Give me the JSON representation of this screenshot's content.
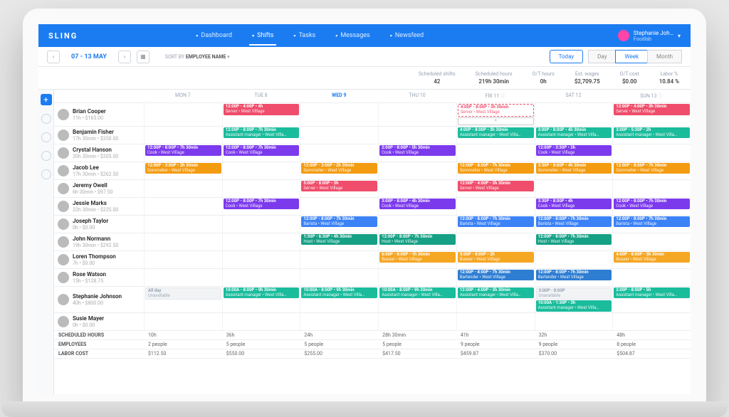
{
  "brand": "SLING",
  "nav": [
    {
      "icon": "dash",
      "label": "Dashboard",
      "active": false
    },
    {
      "icon": "grid",
      "label": "Shifts",
      "active": true
    },
    {
      "icon": "check",
      "label": "Tasks",
      "active": false
    },
    {
      "icon": "msg",
      "label": "Messages",
      "active": false
    },
    {
      "icon": "news",
      "label": "Newsfeed",
      "active": false
    }
  ],
  "user": {
    "name": "Stephanie Joh…",
    "org": "Foodlab"
  },
  "date_range": "07 - 13 MAY",
  "sort_label": "SORT BY",
  "sort_value": "EMPLOYEE NAME",
  "view": {
    "today": "Today",
    "day": "Day",
    "week": "Week",
    "month": "Month"
  },
  "stats": [
    {
      "label": "Scheduled shifts",
      "value": "42"
    },
    {
      "label": "Scheduled hours",
      "value": "219h 30min"
    },
    {
      "label": "O/T hours",
      "value": "0h"
    },
    {
      "label": "Est. wages",
      "value": "$2,709.75"
    },
    {
      "label": "O/T cost",
      "value": "$0.00"
    },
    {
      "label": "Labor %",
      "value": "10.84 %"
    }
  ],
  "days": [
    {
      "label": "MON 7"
    },
    {
      "label": "TUE 8"
    },
    {
      "label": "WED 9",
      "today": true
    },
    {
      "label": "THU 10"
    },
    {
      "label": "FRI 11",
      "info": true
    },
    {
      "label": "SAT 12"
    },
    {
      "label": "SUN 13",
      "info": true
    }
  ],
  "colors": {
    "server": "#ef4d6b",
    "asst": "#1abc9c",
    "cook": "#7c3aed",
    "somm": "#f39c12",
    "barista": "#3b82f6",
    "host": "#16a085",
    "busser": "#f5a623",
    "bartender": "#2d7dd2",
    "grey": "#f1f3f5"
  },
  "employees": [
    {
      "name": "Brian Cooper",
      "sub": "11h • $165.00",
      "shifts": {
        "1": [
          {
            "c": "server",
            "t": "12:00P - 4:00P • 4h",
            "r": "Server • West Village"
          }
        ],
        "4": [
          {
            "c": "server",
            "t": "4:00P - 8:00P • 3h 30min",
            "r": "Server • West Village",
            "outline": true
          },
          {
            "c": "add"
          }
        ],
        "6": [
          {
            "c": "server",
            "t": "12:00P - 4:00P • 3h 30min",
            "r": "Server • West Village"
          }
        ]
      }
    },
    {
      "name": "Benjamin Fisher",
      "sub": "17h 30min • $350.00",
      "shifts": {
        "1": [
          {
            "c": "asst",
            "t": "12:00P - 8:00P • 7h 30min",
            "r": "Assistant manager • West Villa…"
          }
        ],
        "4": [
          {
            "c": "asst",
            "t": "4:00P - 8:00P • 3h 30min",
            "r": "Assistant manager • West Villa…"
          }
        ],
        "5": [
          {
            "c": "asst",
            "t": "3:00P - 8:00P • 4h 30min",
            "r": "Assistant manager • West Villa…"
          }
        ],
        "6": [
          {
            "c": "asst",
            "t": "3:00P - 5:30P • 2h",
            "r": "Assistant manager • West Villa…"
          }
        ]
      }
    },
    {
      "name": "Crystal Hanson",
      "sub": "20h 30min • $205.00",
      "shifts": {
        "0": [
          {
            "c": "cook",
            "t": "12:00P - 8:00P • 7h 30min",
            "r": "Cook • West Village"
          }
        ],
        "1": [
          {
            "c": "cook",
            "t": "12:00P - 8:00P • 7h 30min",
            "r": "Cook • West Village"
          }
        ],
        "3": [
          {
            "c": "cook",
            "t": "2:00P - 8:00P • 5h 30min",
            "r": "Cook • West Village"
          }
        ],
        "5": [
          {
            "c": "cook",
            "t": "12:00P - 3:30P • 3h",
            "r": "Cook • West Village"
          }
        ]
      }
    },
    {
      "name": "Jacob Lee",
      "sub": "17h 30min • $262.50",
      "shifts": {
        "0": [
          {
            "c": "somm",
            "t": "12:00P - 3:00P • 2h 30min",
            "r": "Sommelier • West Village"
          }
        ],
        "2": [
          {
            "c": "somm",
            "t": "12:00P - 3:00P • 2h 30min",
            "r": "Sommelier • West Village"
          }
        ],
        "4": [
          {
            "c": "somm",
            "t": "12:00P - 8:00P • 7h 30min",
            "r": "Sommelier • West Village"
          }
        ],
        "5": [
          {
            "c": "somm",
            "t": "3:30P - 8:00P • 4h 30min",
            "r": "Sommelier • West Village"
          }
        ],
        "6": [
          {
            "c": "somm",
            "t": "12:00P - 8:00P • 7h 30min",
            "r": "Sommelier • West Village"
          }
        ]
      }
    },
    {
      "name": "Jeremy Owell",
      "sub": "6h 30min • $97.50",
      "shifts": {
        "2": [
          {
            "c": "server",
            "t": "5:00P - 8:00P • 3h",
            "r": "Server • West Village"
          }
        ],
        "4": [
          {
            "c": "server",
            "t": "12:00P - 4:00P • 3h 30min",
            "r": "Server • West Village"
          }
        ]
      }
    },
    {
      "name": "Jessie Marks",
      "sub": "22h 30min • $225.00",
      "shifts": {
        "1": [
          {
            "c": "cook",
            "t": "12:00P - 8:00P • 7h 30min",
            "r": "Cook • West Village"
          }
        ],
        "3": [
          {
            "c": "cook",
            "t": "3:00P - 8:00P • 4h 30min",
            "r": "Cook • West Village"
          }
        ],
        "5": [
          {
            "c": "cook",
            "t": "3:30P - 8:00P • 4h",
            "r": "Cook • West Village"
          }
        ],
        "6": [
          {
            "c": "cook",
            "t": "12:00P - 8:00P • 7h 30min",
            "r": "Cook • West Village"
          }
        ]
      }
    },
    {
      "name": "Joseph Taylor",
      "sub": "0h • $0.00",
      "shifts": {
        "2": [
          {
            "c": "barista",
            "t": "12:00P - 8:00P • 7h 30min",
            "r": "Barista • West Village"
          }
        ],
        "4": [
          {
            "c": "barista",
            "t": "12:00P - 8:00P • 7h 30min",
            "r": "Barista • West Village"
          }
        ],
        "5": [
          {
            "c": "barista",
            "t": "12:00P - 8:00P • 7h 30min",
            "r": "Barista • West Village"
          }
        ],
        "6": [
          {
            "c": "barista",
            "t": "12:00P - 8:00P • 7h 30min",
            "r": "Barista • West Village"
          }
        ]
      }
    },
    {
      "name": "John Normann",
      "sub": "19h 30min • $292.50",
      "shifts": {
        "2": [
          {
            "c": "host",
            "t": "1:30P - 6:30P • 4h 30min",
            "r": "Host • West Village"
          }
        ],
        "3": [
          {
            "c": "host",
            "t": "12:00P - 8:00P • 7h 30min",
            "r": "Host • West Village"
          }
        ],
        "5": [
          {
            "c": "host",
            "t": "12:00P - 8:00P • 7h 30min",
            "r": "Host • West Village"
          }
        ]
      }
    },
    {
      "name": "Loren Thompson",
      "sub": "7h • $0.00",
      "shifts": {
        "3": [
          {
            "c": "busser",
            "t": "6:00P - 8:00P • 1h 30min",
            "r": "Busser • West Village"
          }
        ],
        "4": [
          {
            "c": "busser",
            "t": "5:00P - 8:00P • 2h",
            "r": "Busser • West Village"
          }
        ],
        "6": [
          {
            "c": "busser",
            "t": "4:00P - 8:00P • 3h 30min",
            "r": "Busser • West Village"
          }
        ]
      }
    },
    {
      "name": "Rose Watson",
      "sub": "15h • $128.75",
      "shifts": {
        "4": [
          {
            "c": "bartender",
            "t": "12:00P - 8:00P • 7h 30min",
            "r": "Bartender • West Village"
          }
        ],
        "5": [
          {
            "c": "bartender",
            "t": "12:00P - 8:00P • 7h 30min",
            "r": "Bartender • West Village"
          }
        ]
      }
    },
    {
      "name": "Stephanie Johnson",
      "sub": "40h • $800.00",
      "shifts": {
        "0": [
          {
            "c": "grey",
            "t": "All day",
            "r": "Unavailable"
          }
        ],
        "1": [
          {
            "c": "asst",
            "t": "10:00A - 8:00P • 9h 30min",
            "r": "Assistant manager • West Villa…"
          }
        ],
        "2": [
          {
            "c": "asst",
            "t": "10:00A - 8:00P • 9h 30min",
            "r": "Assistant manager • West Villa…"
          }
        ],
        "3": [
          {
            "c": "asst",
            "t": "10:00A - 8:00P • 9h 30min",
            "r": "Assistant manager • West Villa…"
          }
        ],
        "4": [
          {
            "c": "asst",
            "t": "12:00P - 4:00P • 3h 30min",
            "r": "Assistant manager • West Villa…"
          }
        ],
        "5": [
          {
            "c": "grey",
            "t": "3:00P - 8:00P",
            "r": "Unavailable"
          },
          {
            "c": "asst",
            "t": "10:00A - 1:30P • 3h",
            "r": "Assistant manager • West Villa…"
          }
        ],
        "6": [
          {
            "c": "asst",
            "t": "2:00P - 8:00P • 5h",
            "r": "Assistant manager • West Villa…"
          }
        ]
      }
    },
    {
      "name": "Susie Mayer",
      "sub": "0h • $0.00",
      "shifts": {}
    }
  ],
  "footer": [
    {
      "label": "SCHEDULED HOURS",
      "vals": [
        "10h",
        "36h",
        "24h",
        "28h 30min",
        "41h",
        "32h",
        "48h"
      ]
    },
    {
      "label": "EMPLOYEES",
      "vals": [
        "2 people",
        "5 people",
        "5 people",
        "5 people",
        "9 people",
        "9 people",
        "8 people"
      ]
    },
    {
      "label": "LABOR COST",
      "vals": [
        "$112.50",
        "$550.00",
        "$255.00",
        "$417.50",
        "$459.87",
        "$370.00",
        "$504.87"
      ]
    }
  ]
}
